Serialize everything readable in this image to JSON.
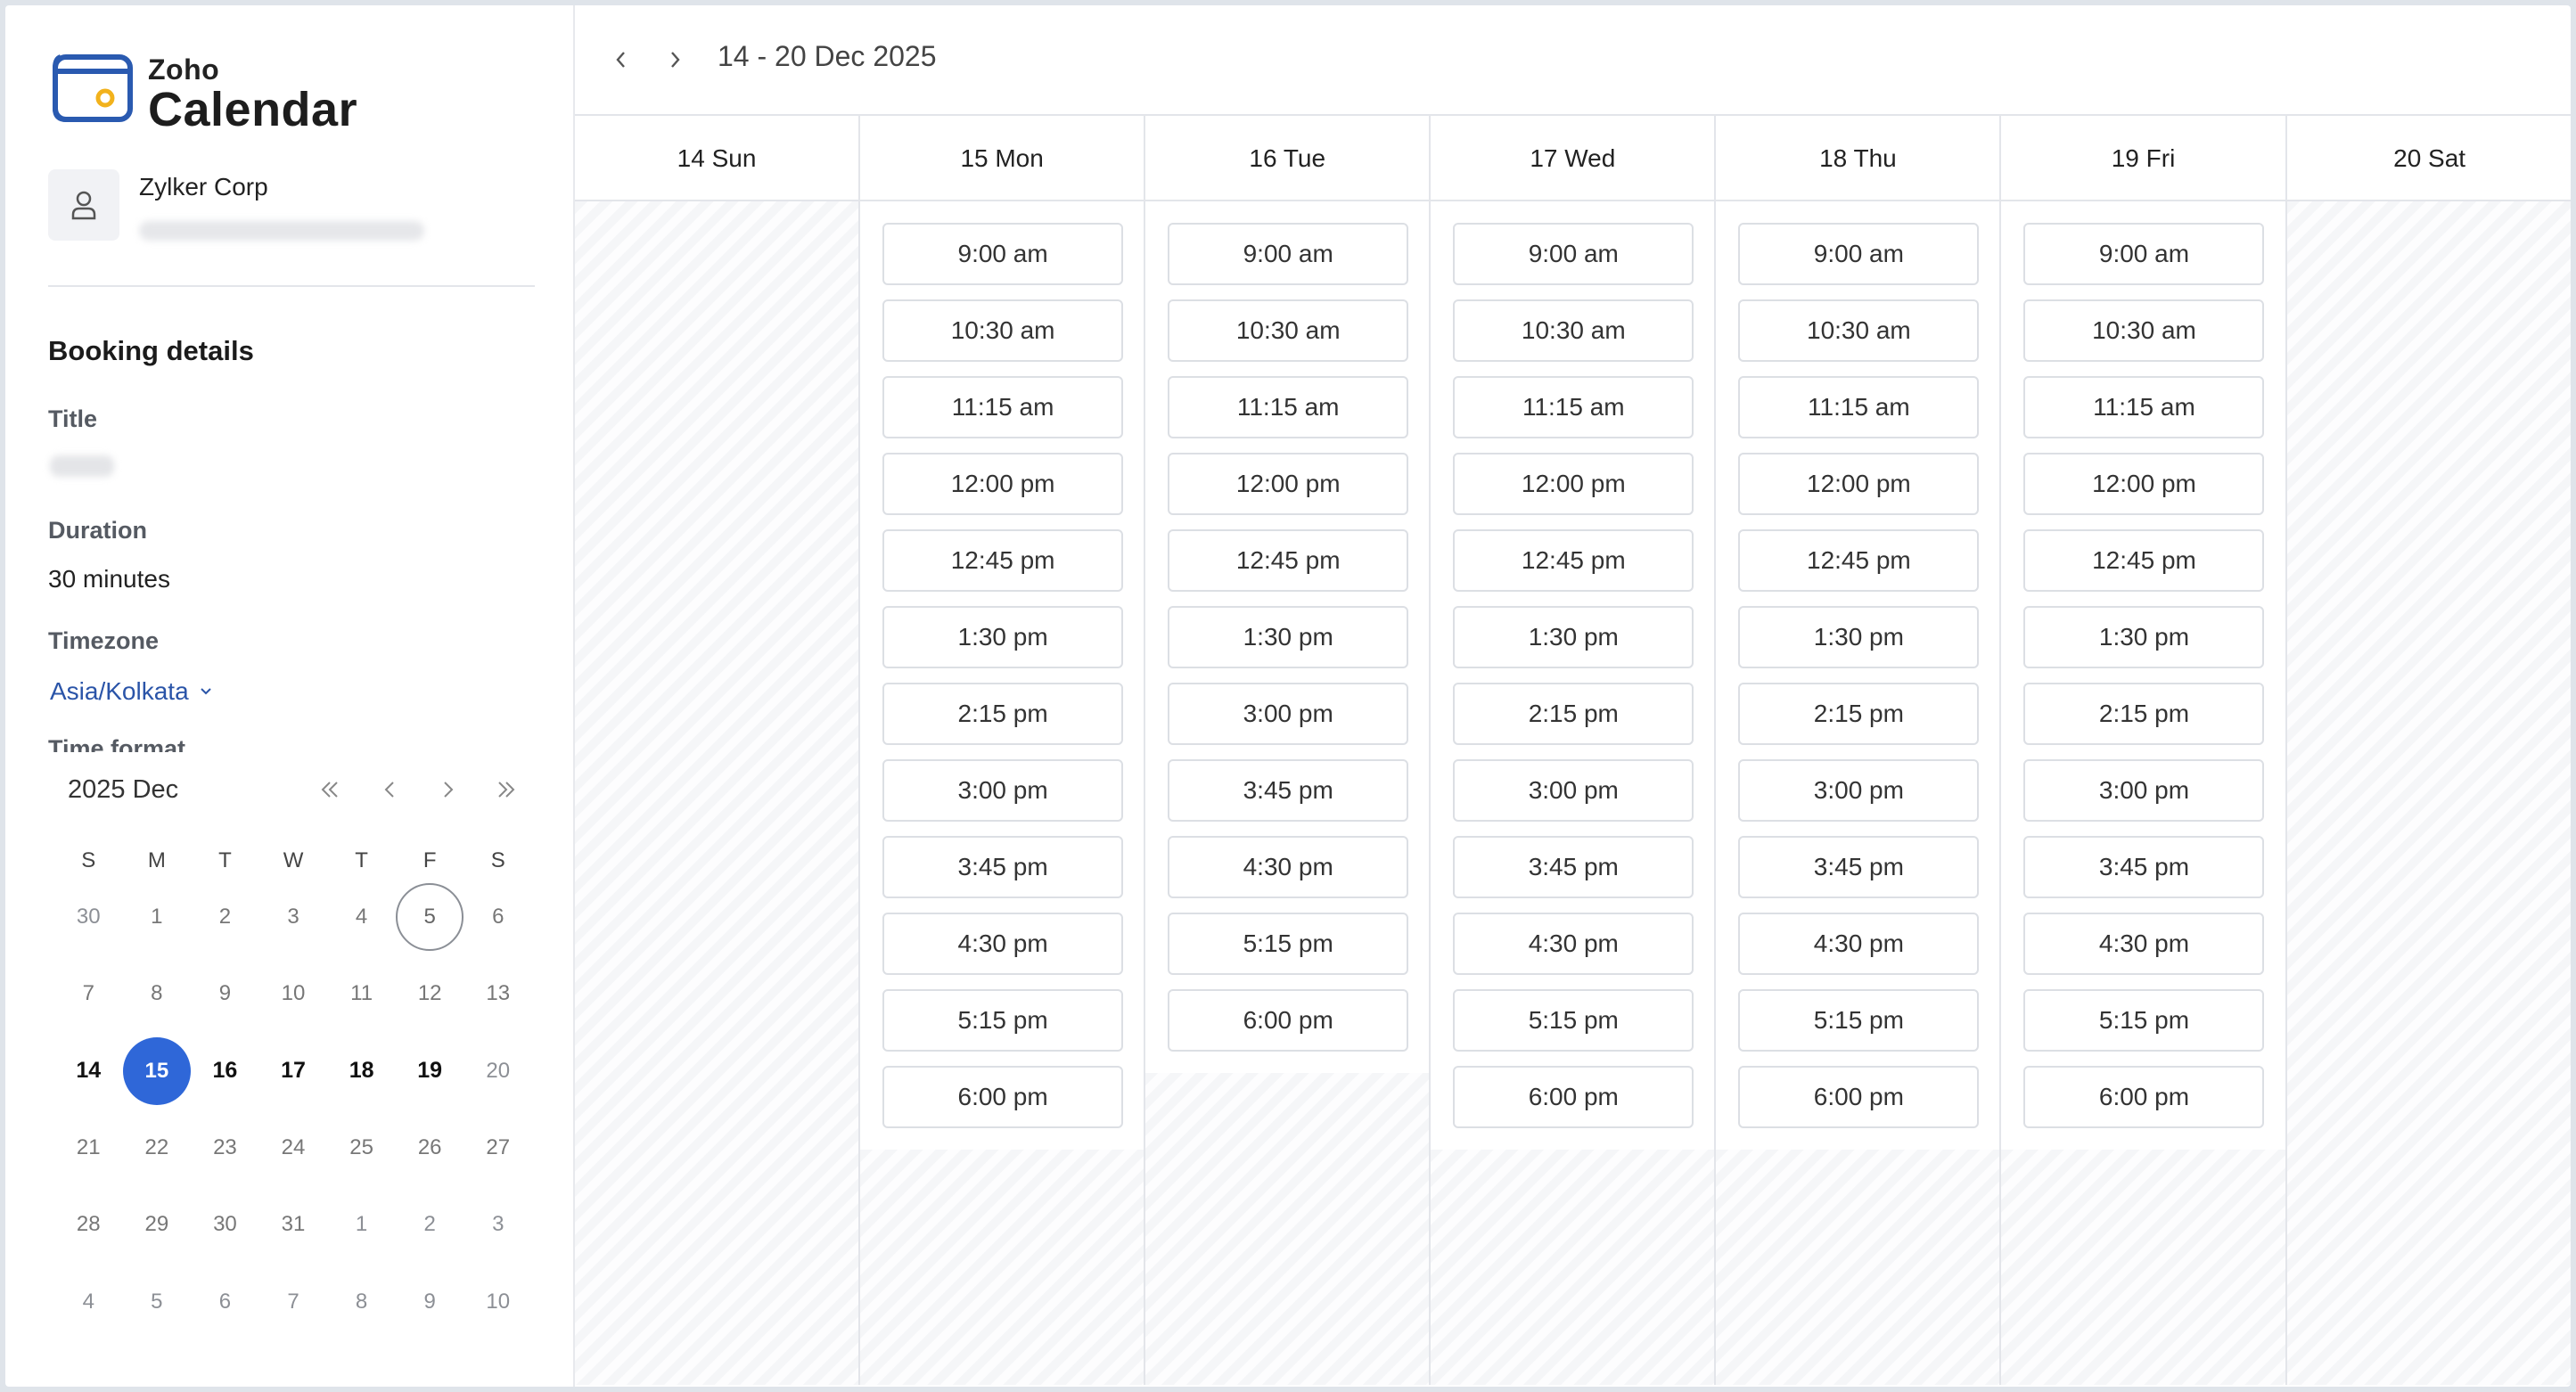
{
  "app": {
    "brand_small": "Zoho",
    "brand_large": "Calendar"
  },
  "org": {
    "name": "Zylker Corp"
  },
  "booking": {
    "section_title": "Booking details",
    "title_label": "Title",
    "duration_label": "Duration",
    "duration_value": "30 minutes",
    "timezone_label": "Timezone",
    "timezone_value": "Asia/Kolkata",
    "time_format_label": "Time format"
  },
  "mini_calendar": {
    "month_label": "2025 Dec",
    "weekdays": [
      "S",
      "M",
      "T",
      "W",
      "T",
      "F",
      "S"
    ],
    "weeks": [
      [
        "30",
        "1",
        "2",
        "3",
        "4",
        "5",
        "6"
      ],
      [
        "7",
        "8",
        "9",
        "10",
        "11",
        "12",
        "13"
      ],
      [
        "14",
        "15",
        "16",
        "17",
        "18",
        "19",
        "20"
      ],
      [
        "21",
        "22",
        "23",
        "24",
        "25",
        "26",
        "27"
      ],
      [
        "28",
        "29",
        "30",
        "31",
        "1",
        "2",
        "3"
      ],
      [
        "4",
        "5",
        "6",
        "7",
        "8",
        "9",
        "10"
      ]
    ],
    "today": "5",
    "selected": "15",
    "selected_color": "#2f67d8"
  },
  "week": {
    "range_label": "14 - 20 Dec 2025",
    "days": [
      {
        "label": "14 Sun",
        "slots": []
      },
      {
        "label": "15 Mon",
        "slots": [
          "9:00 am",
          "10:30 am",
          "11:15 am",
          "12:00 pm",
          "12:45 pm",
          "1:30 pm",
          "2:15 pm",
          "3:00 pm",
          "3:45 pm",
          "4:30 pm",
          "5:15 pm",
          "6:00 pm"
        ]
      },
      {
        "label": "16 Tue",
        "slots": [
          "9:00 am",
          "10:30 am",
          "11:15 am",
          "12:00 pm",
          "12:45 pm",
          "1:30 pm",
          "3:00 pm",
          "3:45 pm",
          "4:30 pm",
          "5:15 pm",
          "6:00 pm"
        ]
      },
      {
        "label": "17 Wed",
        "slots": [
          "9:00 am",
          "10:30 am",
          "11:15 am",
          "12:00 pm",
          "12:45 pm",
          "1:30 pm",
          "2:15 pm",
          "3:00 pm",
          "3:45 pm",
          "4:30 pm",
          "5:15 pm",
          "6:00 pm"
        ]
      },
      {
        "label": "18 Thu",
        "slots": [
          "9:00 am",
          "10:30 am",
          "11:15 am",
          "12:00 pm",
          "12:45 pm",
          "1:30 pm",
          "2:15 pm",
          "3:00 pm",
          "3:45 pm",
          "4:30 pm",
          "5:15 pm",
          "6:00 pm"
        ]
      },
      {
        "label": "19 Fri",
        "slots": [
          "9:00 am",
          "10:30 am",
          "11:15 am",
          "12:00 pm",
          "12:45 pm",
          "1:30 pm",
          "2:15 pm",
          "3:00 pm",
          "3:45 pm",
          "4:30 pm",
          "5:15 pm",
          "6:00 pm"
        ]
      },
      {
        "label": "20 Sat",
        "slots": []
      }
    ]
  },
  "colors": {
    "accent": "#2f67d8",
    "link": "#2a54a8",
    "logo_blue": "#2a5ab0",
    "logo_yellow": "#f2b21c"
  }
}
